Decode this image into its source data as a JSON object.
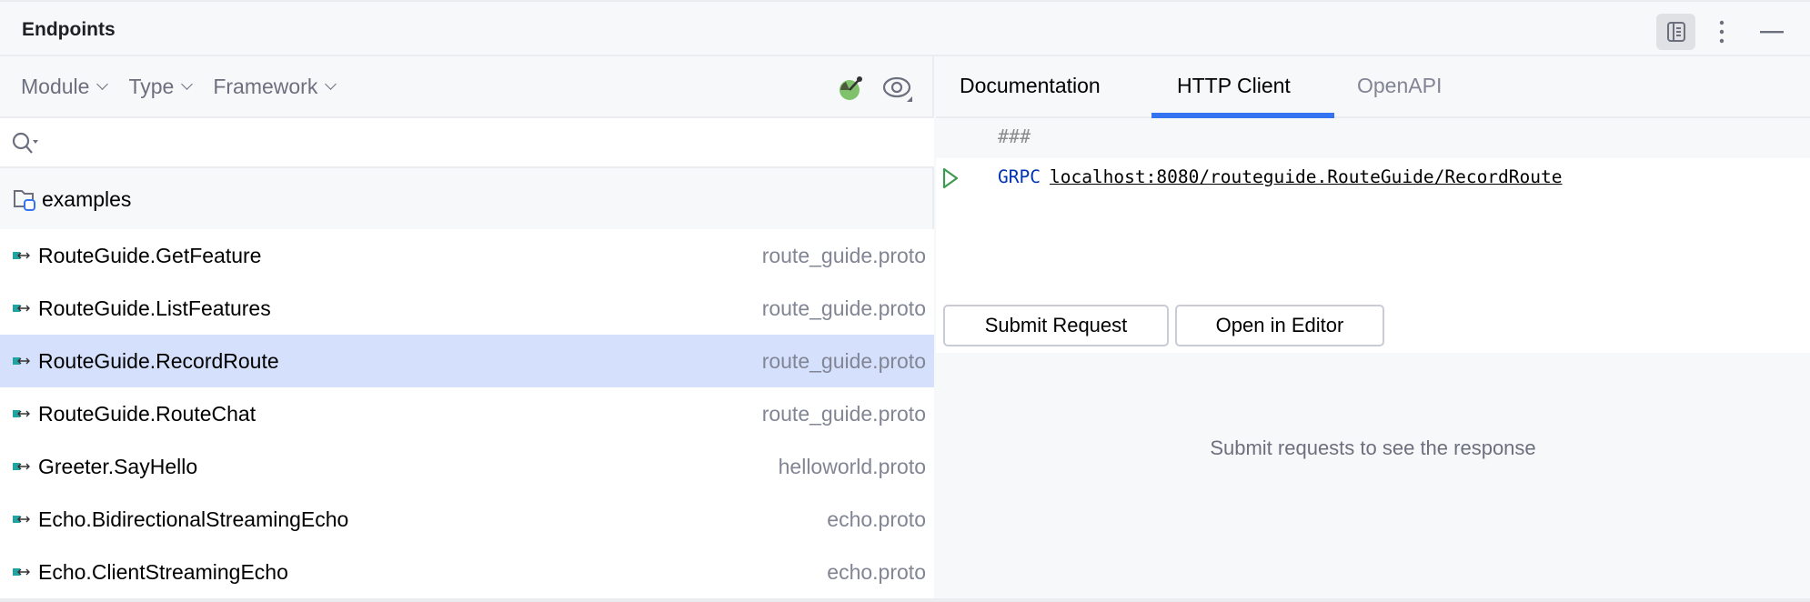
{
  "header": {
    "title": "Endpoints"
  },
  "filters": [
    {
      "label": "Module"
    },
    {
      "label": "Type"
    },
    {
      "label": "Framework"
    }
  ],
  "tree": {
    "module": "examples"
  },
  "endpoints": [
    {
      "name": "RouteGuide.GetFeature",
      "file": "route_guide.proto"
    },
    {
      "name": "RouteGuide.ListFeatures",
      "file": "route_guide.proto"
    },
    {
      "name": "RouteGuide.RecordRoute",
      "file": "route_guide.proto",
      "selected": true
    },
    {
      "name": "RouteGuide.RouteChat",
      "file": "route_guide.proto"
    },
    {
      "name": "Greeter.SayHello",
      "file": "helloworld.proto"
    },
    {
      "name": "Echo.BidirectionalStreamingEcho",
      "file": "echo.proto"
    },
    {
      "name": "Echo.ClientStreamingEcho",
      "file": "echo.proto"
    }
  ],
  "tabs": [
    {
      "label": "Documentation"
    },
    {
      "label": "HTTP Client",
      "active": true
    },
    {
      "label": "OpenAPI"
    }
  ],
  "editor": {
    "comment": "###",
    "method": "GRPC",
    "url": "localhost:8080/routeguide.RouteGuide/RecordRoute"
  },
  "buttons": {
    "submit": "Submit Request",
    "open": "Open in Editor"
  },
  "response": {
    "placeholder": "Submit requests to see the response"
  },
  "colors": {
    "accent": "#3574f0",
    "selection": "#d5e0fc",
    "method": "#0033b3",
    "run": "#3d9a50"
  }
}
